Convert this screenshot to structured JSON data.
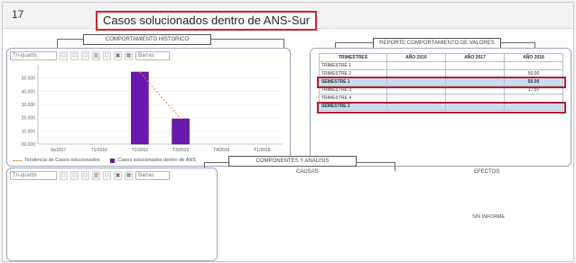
{
  "header": {
    "number": "17",
    "title": "Casos solucionados dentro de ANS-Sur"
  },
  "sections": {
    "chart": "COMPORTAMIENTO HISTORICO",
    "report": "REPORTE COMPORTAMIENTO DE VALORES",
    "analysis": "COMPONENTES Y ANALISIS"
  },
  "chart_toolbar": {
    "combo": "Tri-quartis",
    "tools": [
      "□",
      "□",
      "□",
      "▥",
      "□",
      "▣",
      "▦"
    ],
    "format": "Barras"
  },
  "analysis_toolbar": {
    "combo": "Tri-quartis",
    "tools": [
      "□",
      "□",
      "□",
      "▥",
      "□",
      "▣",
      "▦"
    ],
    "format": "Barras"
  },
  "chart_data": {
    "type": "bar",
    "categories": [
      "3w2017",
      "T1/2016",
      "T2/2016",
      "T3/2016",
      "T4/2016",
      "T1/2018"
    ],
    "values": [
      0,
      0,
      50.0,
      17.5,
      0,
      0
    ],
    "ylim": [
      0,
      55
    ],
    "yticks": [
      "00.000",
      "10.000",
      "20.000",
      "30.000",
      "40.000",
      "50.000"
    ],
    "ylabel": "",
    "xlabel": "",
    "trend": [
      null,
      null,
      50.0,
      17.5,
      null,
      null
    ],
    "legend": [
      "Tendencia de Casos solucionados",
      "Casos solucionados dentro de ANS"
    ],
    "colors": {
      "bar": "#6a18b0",
      "trend": "#e08a4a"
    }
  },
  "report": {
    "columns": [
      "TRIMESTRES",
      "AÑO 2016",
      "AÑO 2017",
      "AÑO 2018"
    ],
    "rows": [
      {
        "label": "TRIMESTRE 1",
        "v2016": "",
        "v2017": "",
        "v2018": ""
      },
      {
        "label": "TRIMESTRE 2",
        "v2016": "",
        "v2017": "",
        "v2018": "50.00"
      },
      {
        "label": "SEMESTRE 1",
        "v2016": "",
        "v2017": "",
        "v2018": "50.00",
        "semester": true
      },
      {
        "label": "TRIMESTRE 3",
        "v2016": "",
        "v2017": "",
        "v2018": "17.50"
      },
      {
        "label": "TRIMESTRE 4",
        "v2016": "",
        "v2017": "",
        "v2018": ""
      },
      {
        "label": "SEMESTRE 2",
        "v2016": "",
        "v2017": "",
        "v2018": "",
        "semester": true
      }
    ]
  },
  "analysis": {
    "col_causas": "CAUSAS",
    "col_efectos": "EFECTOS",
    "efectos_text": "SIN INFORME"
  }
}
